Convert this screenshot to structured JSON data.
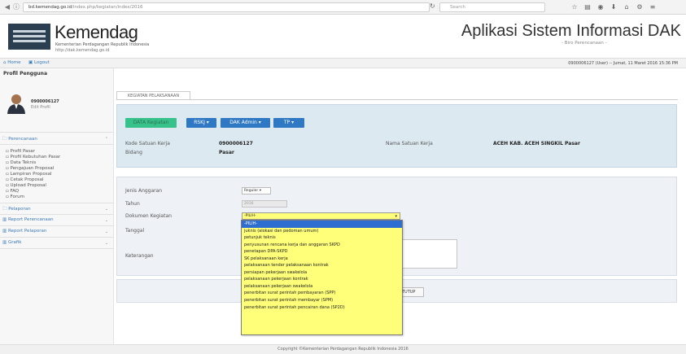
{
  "browser": {
    "url_host": "bd.kemendag.go.id",
    "url_path": "/index.php/kegiatan/index/2016",
    "search_placeholder": "Search"
  },
  "header": {
    "brand": "Kemendag",
    "subtitle": "Kementerian Perdagangan Republik Indonesia",
    "site": "http://dak.kemendag.go.id",
    "app_title": "Aplikasi Sistem Informasi DAK",
    "app_subtitle": "- Biro Perencanaan -"
  },
  "navbar": {
    "home": "Home",
    "logout": "Logout",
    "user_info": "0900006127 (User) -- Jumat, 11 Maret 2016 15:36 PM"
  },
  "sidebar": {
    "title": "Profil Pengguna",
    "user_id": "0900006127",
    "edit_profile": "Edit Profil",
    "perencanaan": "Perencanaan",
    "items": [
      "Profil Pasar",
      "Profil Kebutuhan Pasar",
      "Data Teknis",
      "Pengajuan Proposal",
      "Lampiran Proposal",
      "Cetak Proposal",
      "Upload Proposal",
      "FAQ",
      "Forum"
    ],
    "sections": [
      "Pelaporan",
      "Report Perencanaan",
      "Report Pelaporan",
      "Grafik"
    ]
  },
  "main": {
    "tab": "KEGIATAN PELAKSANAAN",
    "buttons": {
      "first": "DATA Kegiatan",
      "rskj": "RSKJ",
      "dak_admin": "DAK Admin",
      "tp": "TP"
    },
    "info": {
      "kode_label": "Kode Satuan Kerja",
      "kode_value": "0900006127",
      "bidang_label": "Bidang",
      "bidang_value": "Pasar",
      "nama_label": "Nama Satuan Kerja",
      "nama_value": "ACEH KAB. ACEH SINGKIL Pasar"
    },
    "form": {
      "jenis_label": "Jenis Anggaran",
      "jenis_value": "Reguler",
      "tahun_label": "Tahun",
      "tahun_value": "2016",
      "dokumen_label": "Dokumen Kegiatan",
      "dokumen_value": "-PILIH-",
      "tanggal_label": "Tanggal",
      "keterangan_label": "Keterangan",
      "tutup_label": "TUTUP"
    },
    "dropdown_options": [
      "-PILIH-",
      "juknis (alokasi dan pedoman umum)",
      "petunjuk teknis",
      "penyusunan rencana kerja dan anggaran SKPD",
      "penetapan DPA-SKPD",
      "SK pelaksanaan kerja",
      "pelaksanaan tender pelaksanaan kontrak",
      "persiapan pekerjaan swakelola",
      "pelaksanaan pekerjaan kontrak",
      "pelaksanaan pekerjaan swakelola",
      "penerbitan surat perintah pembayaran (SPP)",
      "penerbitan surat perintah membayar (SPM)",
      "penerbitan surat perintah pencairan dana (SP2D)"
    ]
  },
  "footer": {
    "text": "Copyright ©Kementerian Perdagangan Republik Indonesia 2016"
  },
  "colors": {
    "accent": "#2f78c4",
    "green": "#37c28c",
    "highlight": "#ffff7a",
    "selected": "#2f6ed1"
  }
}
